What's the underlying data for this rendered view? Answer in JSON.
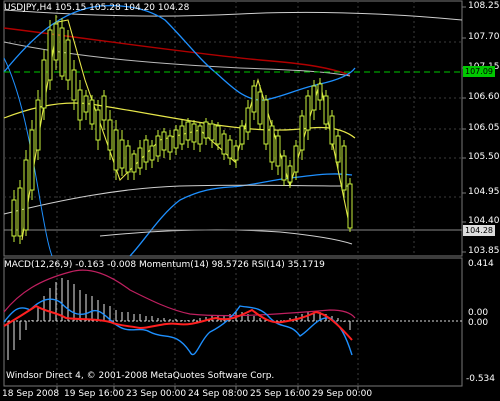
{
  "header": {
    "symbol_line": "USDJPY,H4  105.15 105.28 104.20 104.28"
  },
  "price_axis": {
    "ticks": [
      "108.25",
      "107.70",
      "107.15",
      "106.60",
      "106.05",
      "105.50",
      "104.95",
      "104.40",
      "103.85"
    ],
    "current_price": "104.28",
    "level_price": "107.09"
  },
  "indicator": {
    "label": "MACD(12,26,9) -0.163 -0.008  Momentum(14) 98.5726  RSI(14) 35.1719",
    "axis_ticks": [
      "0.414",
      "0.00",
      "0.00",
      "-0.534"
    ]
  },
  "time_axis": {
    "ticks": [
      "18 Sep 2008",
      "19 Sep 16:00",
      "23 Sep 00:00",
      "24 Sep 08:00",
      "25 Sep 16:00",
      "29 Sep 00:00"
    ]
  },
  "footer": {
    "copyright": "Windsor Direct 4, © 2001-2008 MetaQuotes Software Corp."
  },
  "colors": {
    "background": "#000000",
    "grid": "#4a4a4a",
    "candle": "#c8f03c",
    "envelope_blue": "#1e90ff",
    "ma_yellow": "#e6e64a",
    "ma_red": "#b00000",
    "level_green": "#00c800",
    "macd_red": "#ff2020",
    "signal_pink": "#c02060"
  }
}
